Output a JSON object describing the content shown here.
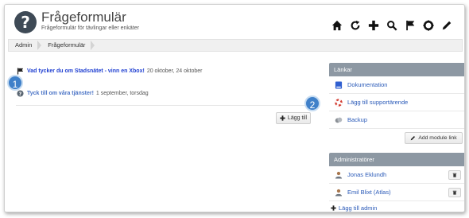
{
  "app": {
    "title": "Frågeformulär",
    "subtitle": "Frågeformulär för tävlingar eller enkäter",
    "logo_icon": "question-logo-icon"
  },
  "toolbar": {
    "icons": [
      "home-icon",
      "refresh-icon",
      "plus-icon",
      "search-icon",
      "flag-icon",
      "lifebuoy-icon",
      "pencil-icon"
    ]
  },
  "breadcrumb": {
    "items": [
      "Admin",
      "Frågeformulär"
    ]
  },
  "polls": [
    {
      "title": "Vad tycker du om Stadsnätet - vinn en Xbox!",
      "dates": "20 oktober, 24 oktober",
      "icon": "flag-icon"
    },
    {
      "title": "Tyck till om våra tjänster!",
      "dates": "1 september, torsdag",
      "icon": "question-icon"
    }
  ],
  "add_button": {
    "label": "Lägg till",
    "icon": "plus-icon"
  },
  "badges": [
    "1",
    "2"
  ],
  "links_panel": {
    "title": "Länkar",
    "items": [
      {
        "label": "Dokumentation",
        "icon": "book-icon"
      },
      {
        "label": "Lägg till supportärende",
        "icon": "lifebuoy-icon"
      },
      {
        "label": "Backup",
        "icon": "backup-icon"
      }
    ],
    "add_module_label": "Add module link"
  },
  "admins_panel": {
    "title": "Administratörer",
    "admins": [
      {
        "name": "Jonas Eklundh",
        "icon": "user-icon"
      },
      {
        "name": "Emil Blixt (Atlas)",
        "icon": "user-icon"
      }
    ],
    "add_admin_label": "Lägg till admin"
  },
  "colors": {
    "link": "#1f3fd1",
    "panel_header": "#8d98a3",
    "badge": "#3f80c9"
  }
}
